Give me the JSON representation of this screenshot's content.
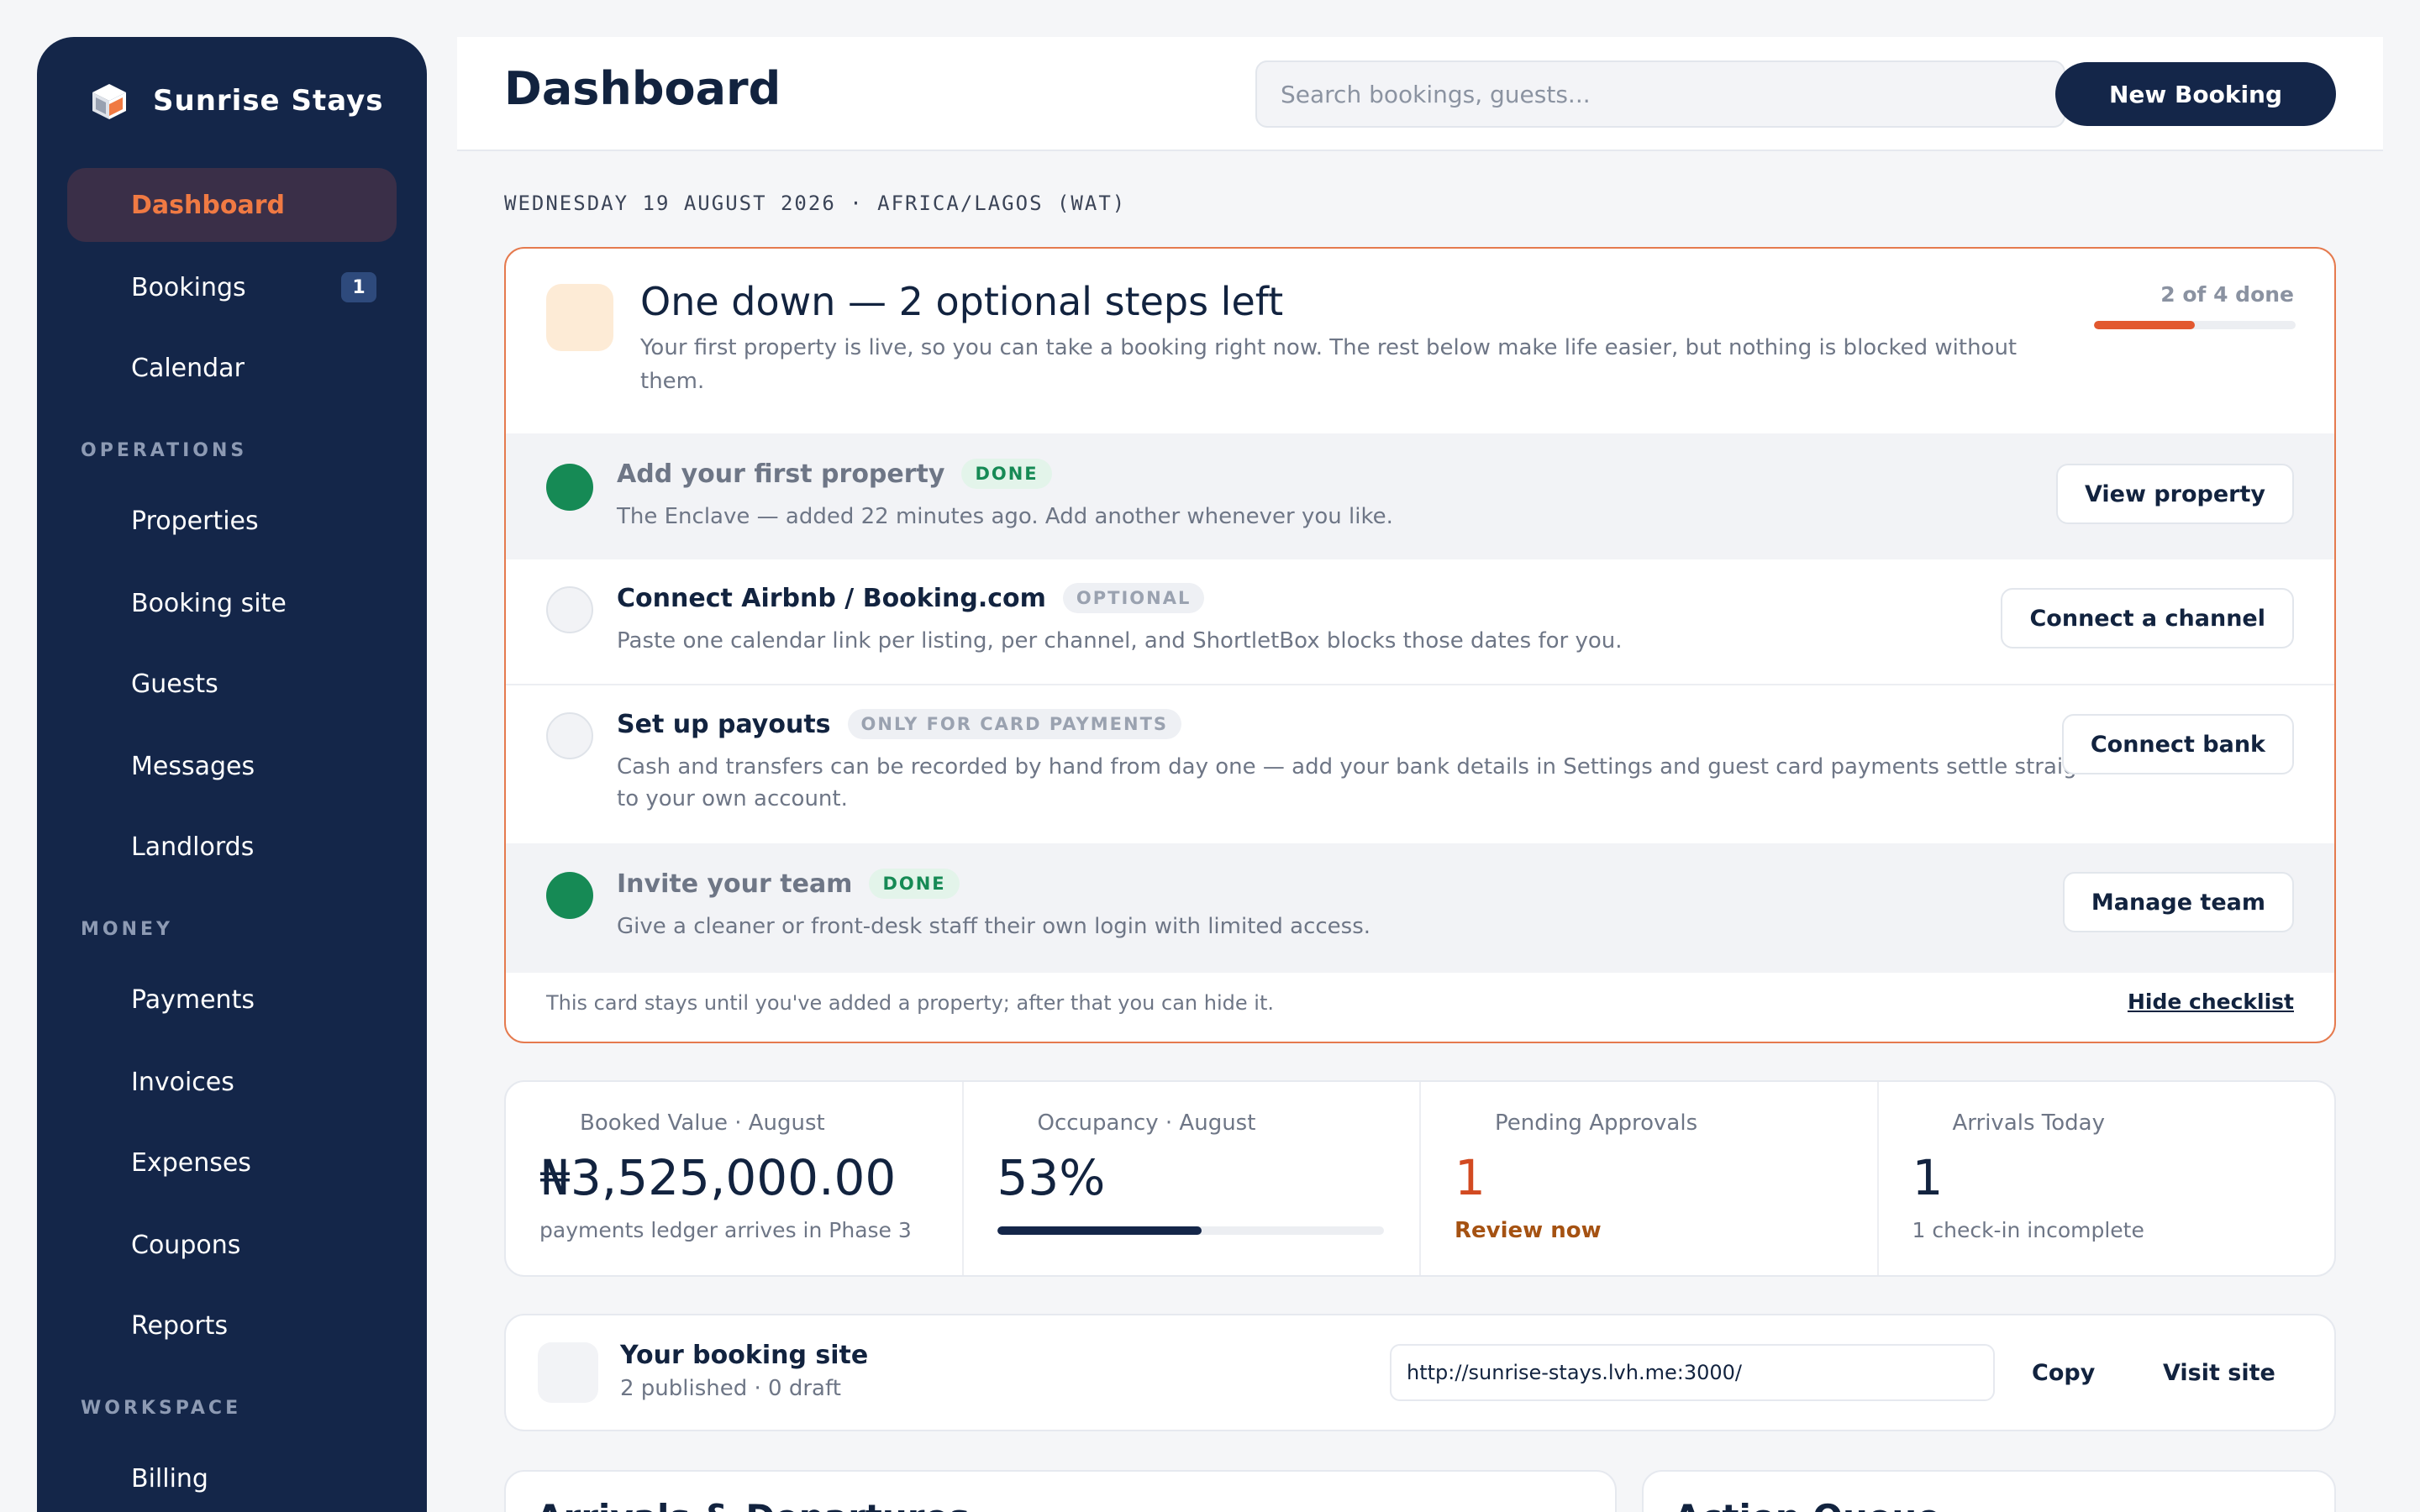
{
  "sidebar": {
    "brand": "Sunrise Stays",
    "items": [
      {
        "label": "Dashboard"
      },
      {
        "label": "Bookings",
        "badge": "1"
      },
      {
        "label": "Calendar"
      },
      {
        "label": "Properties"
      },
      {
        "label": "Booking site"
      },
      {
        "label": "Guests"
      },
      {
        "label": "Messages"
      },
      {
        "label": "Landlords"
      },
      {
        "label": "Payments"
      },
      {
        "label": "Invoices"
      },
      {
        "label": "Expenses"
      },
      {
        "label": "Coupons"
      },
      {
        "label": "Reports"
      },
      {
        "label": "Billing"
      }
    ],
    "sections": [
      "OPERATIONS",
      "MONEY",
      "WORKSPACE"
    ]
  },
  "header": {
    "title": "Dashboard",
    "search_placeholder": "Search bookings, guests...",
    "new_booking_label": "New Booking"
  },
  "date_line": "WEDNESDAY 19 AUGUST 2026 · AFRICA/LAGOS (WAT)",
  "checklist": {
    "title": "One down — 2 optional steps left",
    "subtitle": "Your first property is live, so you can take a booking right now. The rest below make life easier, but nothing is blocked without them.",
    "progress_label": "2 of 4 done",
    "progress_fraction": 0.5,
    "steps": [
      {
        "title": "Add your first property",
        "tag": "DONE",
        "description": "The Enclave — added 22 minutes ago. Add another whenever you like.",
        "button": "View property"
      },
      {
        "title": "Connect Airbnb / Booking.com",
        "tag": "OPTIONAL",
        "description": "Paste one calendar link per listing, per channel, and ShortletBox blocks those dates for you.",
        "button": "Connect a channel"
      },
      {
        "title": "Set up payouts",
        "tag": "ONLY FOR CARD PAYMENTS",
        "description": "Cash and transfers can be recorded by hand from day one — add your bank details in Settings and guest card payments settle straight to your own account.",
        "button": "Connect bank"
      },
      {
        "title": "Invite your team",
        "tag": "DONE",
        "description": "Give a cleaner or front-desk staff their own login with limited access.",
        "button": "Manage team"
      }
    ],
    "footer_note": "This card stays until you've added a property; after that you can hide it.",
    "hide_label": "Hide checklist"
  },
  "stats": [
    {
      "label": "Booked Value · August",
      "value": "₦3,525,000.00",
      "note": "payments ledger arrives in Phase 3"
    },
    {
      "label": "Occupancy · August",
      "value": "53%",
      "fraction": 0.53
    },
    {
      "label": "Pending Approvals",
      "value": "1",
      "link": "Review now"
    },
    {
      "label": "Arrivals Today",
      "value": "1",
      "note": "1 check-in incomplete"
    }
  ],
  "booking_site": {
    "title": "Your booking site",
    "subtitle": "2 published · 0 draft",
    "url": "http://sunrise-stays.lvh.me:3000/",
    "copy_label": "Copy",
    "visit_label": "Visit site"
  },
  "bottom_cards": [
    {
      "title": "Arrivals & Departures"
    },
    {
      "title": "Action Queue"
    }
  ],
  "colors": {
    "sidebar_bg": "#142649",
    "accent": "#f07a43",
    "success": "#168a55",
    "warning": "#d24a21"
  }
}
